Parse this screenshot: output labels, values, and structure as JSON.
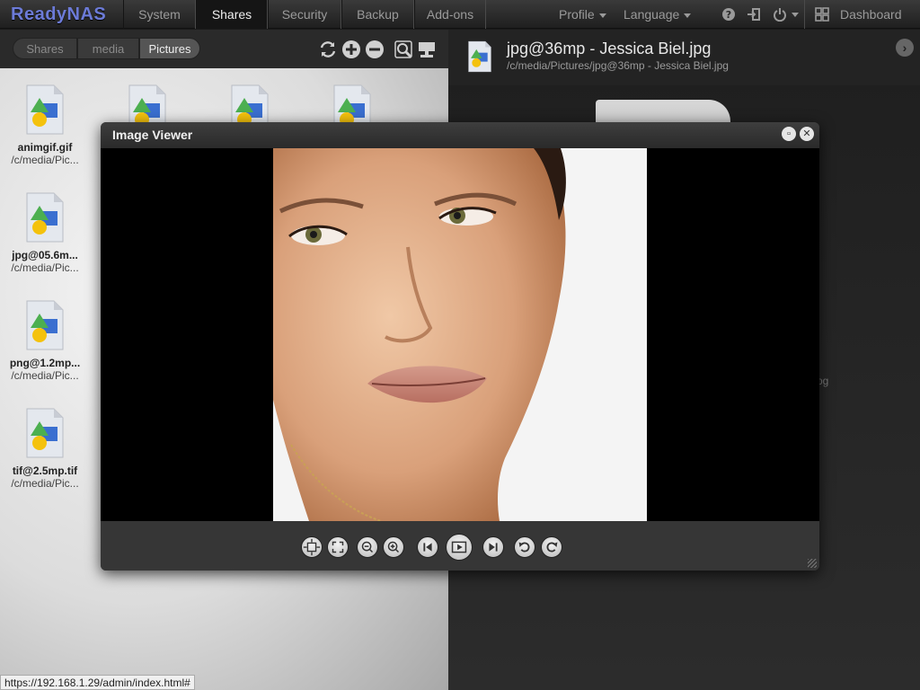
{
  "app": {
    "logo": "ReadyNAS"
  },
  "nav": {
    "tabs": [
      {
        "label": "System"
      },
      {
        "label": "Shares"
      },
      {
        "label": "Security"
      },
      {
        "label": "Backup"
      },
      {
        "label": "Add-ons"
      }
    ],
    "profile": "Profile",
    "language": "Language",
    "dashboard": "Dashboard"
  },
  "breadcrumb": [
    "Shares",
    "media",
    "Pictures"
  ],
  "files": [
    {
      "name": "animgif.gif",
      "path": "/c/media/Pic..."
    },
    {
      "name": "jpg@05.6m...",
      "path": "/c/media/Pic..."
    },
    {
      "name": "png@1.2mp...",
      "path": "/c/media/Pic..."
    },
    {
      "name": "tif@2.5mp.tif",
      "path": "/c/media/Pic..."
    }
  ],
  "details": {
    "title": "jpg@36mp - Jessica Biel.jpg",
    "path": "/c/media/Pictures/jpg@36mp - Jessica Biel.jpg",
    "side_fragment": "pg"
  },
  "viewer": {
    "title": "Image Viewer"
  },
  "status": {
    "url": "https://192.168.1.29/admin/index.html#"
  },
  "colors": {
    "accent": "#6c7bd8",
    "active_tab": "#151515"
  }
}
